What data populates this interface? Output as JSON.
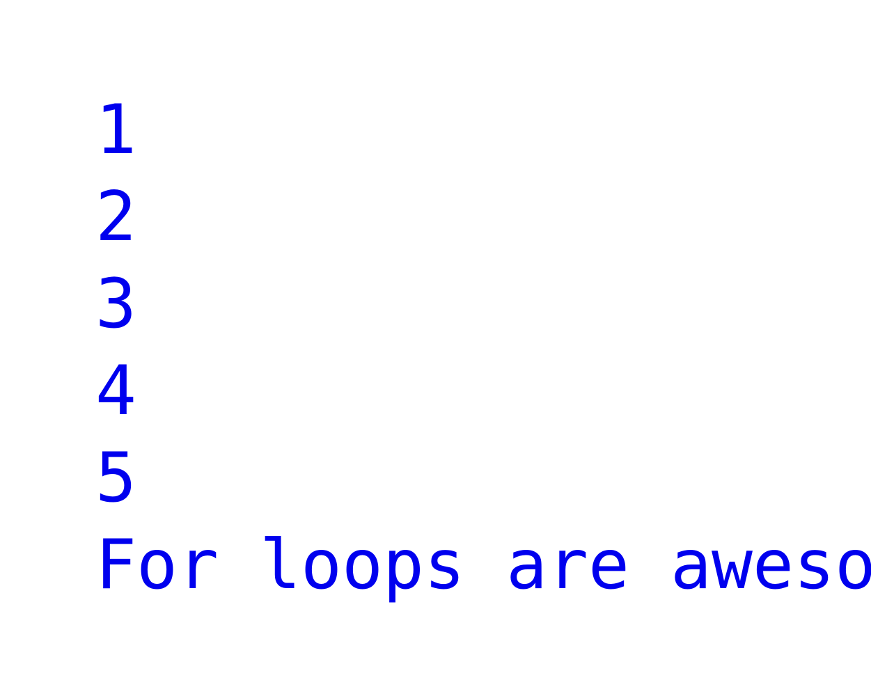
{
  "colors": {
    "text": "#0000ee",
    "background": "#ffffff"
  },
  "output": {
    "lines": [
      "1",
      "2",
      "3",
      "4",
      "5",
      "For loops are awesome!"
    ]
  }
}
